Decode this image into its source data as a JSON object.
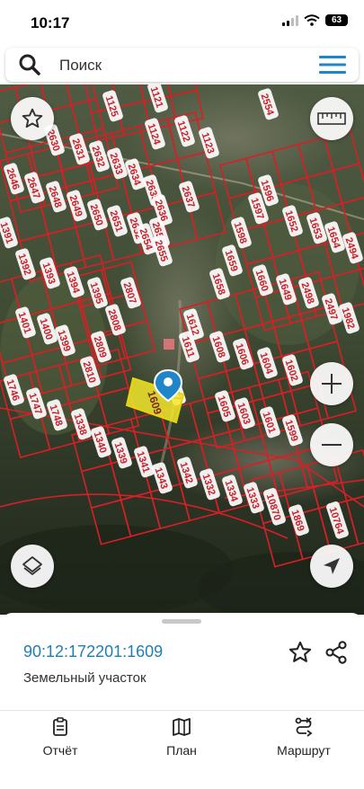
{
  "status": {
    "time": "10:17",
    "battery": "63"
  },
  "search": {
    "placeholder": "Поиск"
  },
  "map": {
    "parcel_labels": [
      "1125",
      "1121",
      "2554",
      "2630",
      "2631",
      "2632",
      "2633",
      "2634",
      "1124",
      "1122",
      "1123",
      "2646",
      "2647",
      "2648",
      "2649",
      "2650",
      "2651",
      "2652",
      "2653",
      "2635",
      "2636",
      "2637",
      "1596",
      "1597",
      "1652",
      "1653",
      "1654",
      "1598",
      "1659",
      "1391",
      "1392",
      "1393",
      "1394",
      "2654",
      "2655",
      "1658",
      "1660",
      "1649",
      "2498",
      "2494",
      "2497",
      "2807",
      "2808",
      "1395",
      "1401",
      "1400",
      "1399",
      "2809",
      "2810",
      "1612",
      "1611",
      "1608",
      "1606",
      "1604",
      "1602",
      "1982",
      "1607",
      "1605",
      "1603",
      "1601",
      "1599",
      "1609",
      "1746",
      "1747",
      "1748",
      "1338",
      "1340",
      "1339",
      "1341",
      "1343",
      "1342",
      "1332",
      "1334",
      "1333",
      "10870",
      "1869",
      "10764"
    ],
    "selected_parcel": "1609"
  },
  "details": {
    "cadastral_number": "90:12:172201:1609",
    "object_type": "Земельный участок"
  },
  "tabs": [
    {
      "label": "Отчёт",
      "icon": "report-icon"
    },
    {
      "label": "План",
      "icon": "map-plan-icon"
    },
    {
      "label": "Маршрут",
      "icon": "route-icon"
    }
  ],
  "colors": {
    "parcel_border": "#d81f26",
    "selected_parcel_fill": "#f3e92c",
    "marker": "#1f86c9",
    "link": "#1c7fb6"
  }
}
